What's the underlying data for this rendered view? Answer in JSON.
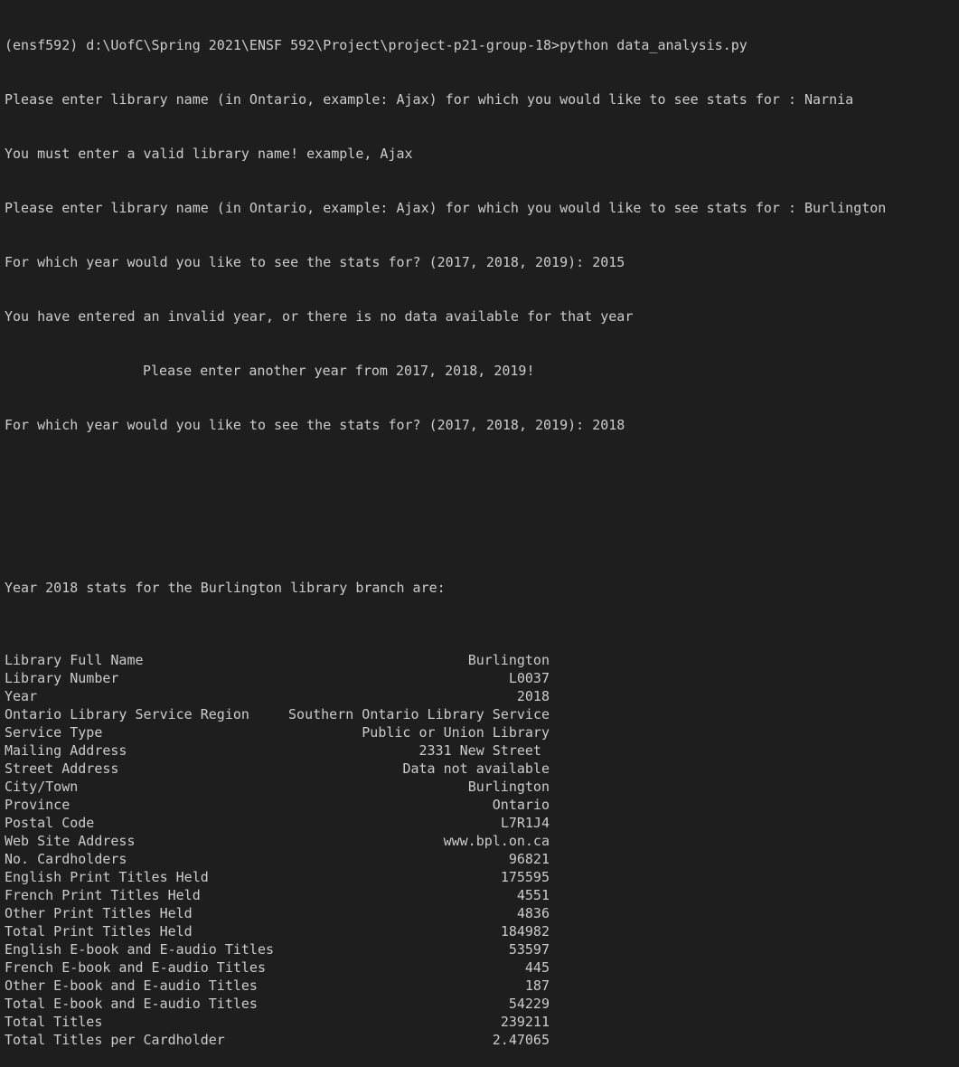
{
  "terminal": {
    "lines": [
      "(ensf592) d:\\UofC\\Spring 2021\\ENSF 592\\Project\\project-p21-group-18>python data_analysis.py",
      "Please enter library name (in Ontario, example: Ajax) for which you would like to see stats for : Narnia",
      "You must enter a valid library name! example, Ajax",
      "Please enter library name (in Ontario, example: Ajax) for which you would like to see stats for : Burlington",
      "For which year would you like to see the stats for? (2017, 2018, 2019): 2015",
      "You have entered an invalid year, or there is no data available for that year",
      "Please enter another year from 2017, 2018, 2019!",
      "For which year would you like to see the stats for? (2017, 2018, 2019): 2018"
    ],
    "stats_header": "Year 2018 stats for the Burlington library branch are:",
    "stats": [
      {
        "key": "Library Full Name",
        "value": "Burlington"
      },
      {
        "key": "Library Number",
        "value": "L0037"
      },
      {
        "key": "Year",
        "value": "2018"
      },
      {
        "key": "Ontario Library Service Region",
        "value": "Southern Ontario Library Service"
      },
      {
        "key": "Service Type",
        "value": "Public or Union Library"
      },
      {
        "key": "Mailing Address",
        "value": "2331 New Street "
      },
      {
        "key": "Street Address",
        "value": "Data not available"
      },
      {
        "key": "City/Town",
        "value": "Burlington"
      },
      {
        "key": "Province",
        "value": "Ontario"
      },
      {
        "key": "Postal Code",
        "value": "L7R1J4"
      },
      {
        "key": "Web Site Address",
        "value": "www.bpl.on.ca"
      },
      {
        "key": "No. Cardholders",
        "value": "96821"
      },
      {
        "key": "English Print Titles Held",
        "value": "175595"
      },
      {
        "key": "French Print Titles Held",
        "value": "4551"
      },
      {
        "key": "Other Print Titles Held",
        "value": "4836"
      },
      {
        "key": "Total Print Titles Held",
        "value": "184982"
      },
      {
        "key": "English E-book and E-audio Titles",
        "value": "53597"
      },
      {
        "key": "French E-book and E-audio Titles",
        "value": "445"
      },
      {
        "key": "Other E-book and E-audio Titles",
        "value": "187"
      },
      {
        "key": "Total E-book and E-audio Titles",
        "value": "54229"
      },
      {
        "key": "Total Titles",
        "value": "239211"
      },
      {
        "key": "Total Titles per Cardholder",
        "value": "2.47065"
      }
    ]
  }
}
